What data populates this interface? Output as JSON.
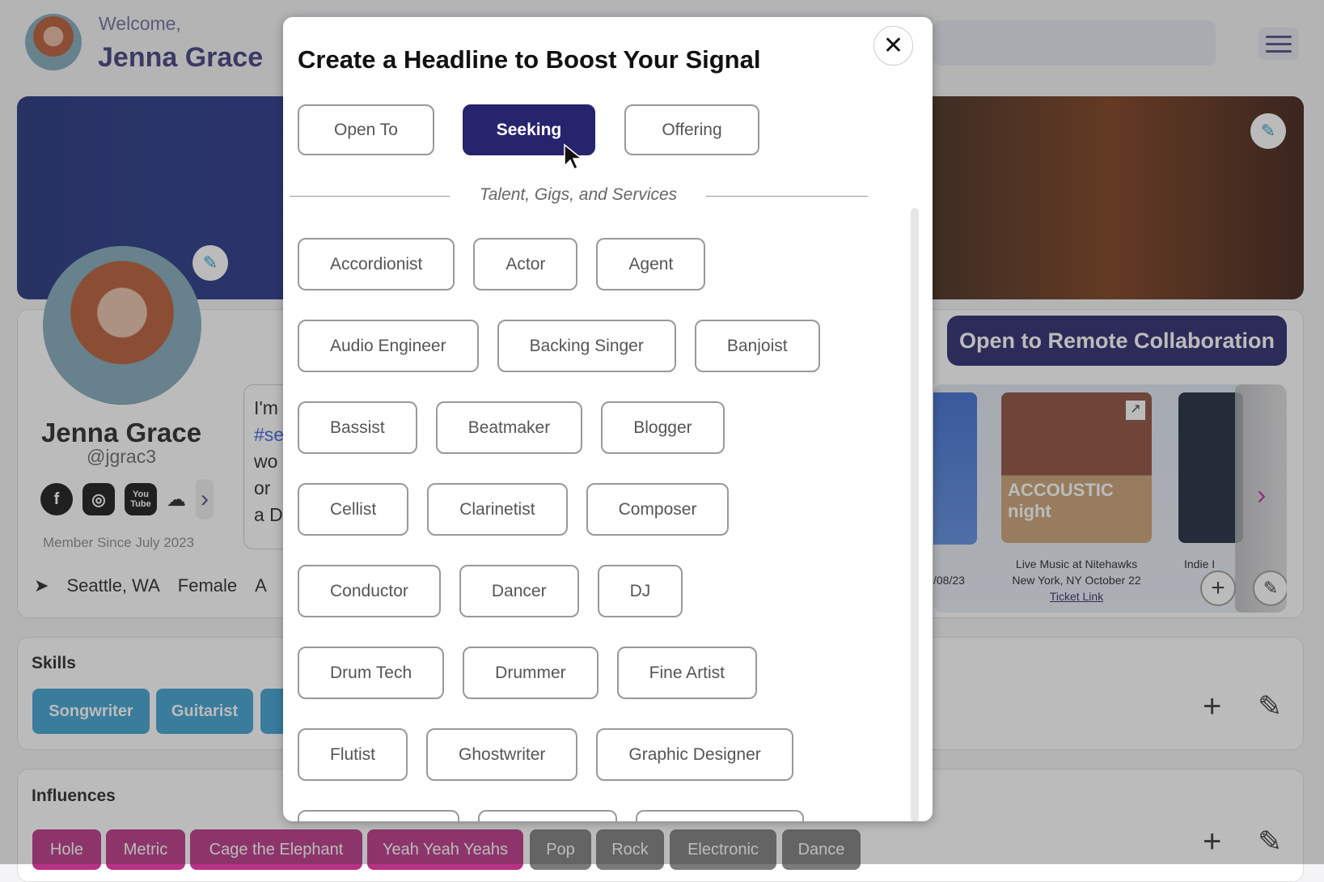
{
  "header": {
    "welcome": "Welcome,",
    "user_name": "Jenna Grace"
  },
  "profile": {
    "name": "Jenna Grace",
    "handle": "@jgrac3",
    "member_since": "Member Since July 2023",
    "location": "Seattle, WA",
    "gender": "Female",
    "gender_next": "A",
    "bio_lines": [
      "I'm",
      "#se",
      "wo",
      "or",
      "a D"
    ],
    "socials": [
      "facebook-icon",
      "instagram-icon",
      "youtube-icon",
      "soundcloud-icon"
    ],
    "youtube_text": "You Tube"
  },
  "remote_button": "Open to Remote Collaboration",
  "gigs": [
    {
      "caption_partial": "/08/23"
    },
    {
      "title": "Live Music at Nitehawks",
      "subtitle": "New York, NY October 22",
      "link": "Ticket Link",
      "poster_text": "ACCOUSTIC night"
    },
    {
      "title_partial": "Indie I"
    }
  ],
  "skills": {
    "title": "Skills",
    "items": [
      "Songwriter",
      "Guitarist"
    ],
    "color": "#3a9fcf"
  },
  "influences": {
    "title": "Influences",
    "items": [
      {
        "label": "Hole",
        "color": "#b83284"
      },
      {
        "label": "Metric",
        "color": "#b83284"
      },
      {
        "label": "Cage the Elephant",
        "color": "#b83284"
      },
      {
        "label": "Yeah Yeah Yeahs",
        "color": "#b83284"
      },
      {
        "label": "Pop",
        "color": "#7a7a7a"
      },
      {
        "label": "Rock",
        "color": "#7a7a7a"
      },
      {
        "label": "Electronic",
        "color": "#7a7a7a"
      },
      {
        "label": "Dance",
        "color": "#7a7a7a"
      }
    ]
  },
  "modal": {
    "title": "Create a Headline to Boost Your Signal",
    "close": "✕",
    "tabs": [
      {
        "label": "Open To",
        "active": false
      },
      {
        "label": "Seeking",
        "active": true
      },
      {
        "label": "Offering",
        "active": false
      }
    ],
    "section": "Talent, Gigs, and Services",
    "accent": "#27246e",
    "rows": [
      [
        "Accordionist",
        "Actor",
        "Agent"
      ],
      [
        "Audio Engineer",
        "Backing Singer",
        "Banjoist"
      ],
      [
        "Bassist",
        "Beatmaker",
        "Blogger"
      ],
      [
        "Cellist",
        "Clarinetist",
        "Composer"
      ],
      [
        "Conductor",
        "Dancer",
        "DJ"
      ],
      [
        "Drum Tech",
        "Drummer",
        "Fine Artist"
      ],
      [
        "Flutist",
        "Ghostwriter",
        "Graphic Designer"
      ]
    ]
  }
}
